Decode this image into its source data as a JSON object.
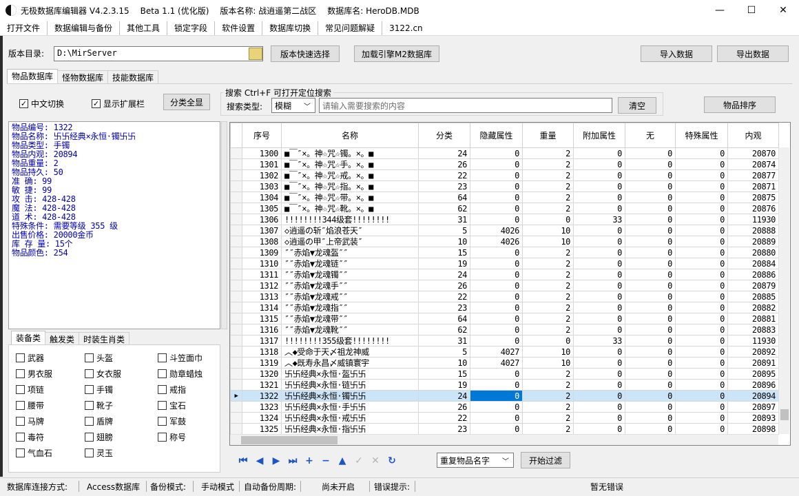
{
  "window": {
    "title_segments": [
      "无极数据库编辑器 V4.2.3.15",
      "Beta 1.1 (优化版)",
      "版本名称: 战逍遥第二战区",
      "数据库名: HeroDB.MDB"
    ],
    "minimize": "—",
    "maximize": "☐",
    "close": "✕"
  },
  "menu": [
    "打开文件",
    "数据编辑与备份",
    "其他工具",
    "锁定字段",
    "软件设置",
    "数据库切换",
    "常见问题解疑",
    "3122.cn"
  ],
  "path": {
    "label": "版本目录:",
    "value": "D:\\MirServer",
    "quick_select": "版本快速选择",
    "load_m2": "加载引擎M2数据库",
    "import": "导入数据",
    "export": "导出数据"
  },
  "top_tabs": [
    "物品数据库",
    "怪物数据库",
    "技能数据库"
  ],
  "options": {
    "cn_switch": "中文切换",
    "show_ext": "显示扩展栏",
    "show_all": "分类全显",
    "search_legend": "搜索  Ctrl+F 可打开定位搜索",
    "search_type_label": "搜索类型:",
    "search_type_value": "模糊",
    "search_placeholder": "请输入需要搜索的内容",
    "clear": "清空",
    "sort": "物品排序"
  },
  "info": [
    "物品编号: 1322",
    "物品名称: 卐卐经典×永恒·镯卐卐",
    "物品类型: 手镯",
    "物品内观: 20894",
    "物品重量: 2",
    "物品持久: 50",
    "准    确: 99",
    "敏    捷: 99",
    "攻    击: 428-428",
    "魔    法: 428-428",
    "道    术: 428-428",
    "特殊条件: 需要等级 355 级",
    "出售价格: 20000金币",
    "库 存 量: 15个",
    "物品颜色: 254"
  ],
  "cat_tabs": [
    "装备类",
    "触发类",
    "时装生肖类"
  ],
  "categories": [
    "武器",
    "头盔",
    "斗笠面巾",
    "男衣服",
    "女衣服",
    "勋章蜡烛",
    "项链",
    "手镯",
    "戒指",
    "腰带",
    "靴子",
    "宝石",
    "马牌",
    "盾牌",
    "军鼓",
    "毒符",
    "翅膀",
    "称号",
    "气血石",
    "灵玉"
  ],
  "table": {
    "columns": [
      "序号",
      "名称",
      "分类",
      "隐藏属性",
      "重量",
      "附加属性",
      "无",
      "特殊属性",
      "内观"
    ],
    "rows": [
      [
        "1300",
        "■￣″×。神☆咒☆镯。×。■",
        "24",
        "0",
        "2",
        "0",
        "0",
        "0",
        "20870"
      ],
      [
        "1301",
        "■￣″×。神☆咒☆手。×。■",
        "26",
        "0",
        "2",
        "0",
        "0",
        "0",
        "20874"
      ],
      [
        "1302",
        "■￣″×。神☆咒☆戒。×。■",
        "22",
        "0",
        "2",
        "0",
        "0",
        "0",
        "20877"
      ],
      [
        "1303",
        "■￣″×。神☆咒☆指。×。■",
        "23",
        "0",
        "2",
        "0",
        "0",
        "0",
        "20871"
      ],
      [
        "1304",
        "■￣″×。神☆咒☆带。×。■",
        "64",
        "0",
        "2",
        "0",
        "0",
        "0",
        "20875"
      ],
      [
        "1305",
        "■￣″×。神☆咒☆靴。×。■",
        "62",
        "0",
        "2",
        "0",
        "0",
        "0",
        "20876"
      ],
      [
        "1306",
        "!!!!!!!!344级套!!!!!!!!",
        "31",
        "0",
        "0",
        "33",
        "0",
        "0",
        "11930"
      ],
      [
        "1307",
        "◇逍遥の斩″焰浪苍天″",
        "5",
        "4026",
        "10",
        "0",
        "0",
        "0",
        "20888"
      ],
      [
        "1308",
        "◇逍遥の甲″上帝武装″",
        "10",
        "4026",
        "10",
        "0",
        "0",
        "0",
        "20889"
      ],
      [
        "1309",
        "″″赤焰▼龙魂盔″″",
        "15",
        "0",
        "2",
        "0",
        "0",
        "0",
        "20880"
      ],
      [
        "1310",
        "″″赤焰▼龙魂链″″",
        "19",
        "0",
        "2",
        "0",
        "0",
        "0",
        "20884"
      ],
      [
        "1311",
        "″″赤焰▼龙魂镯″″",
        "24",
        "0",
        "2",
        "0",
        "0",
        "0",
        "20886"
      ],
      [
        "1312",
        "″″赤焰▼龙魂手″″",
        "26",
        "0",
        "2",
        "0",
        "0",
        "0",
        "20879"
      ],
      [
        "1313",
        "″″赤焰▼龙魂戒″″",
        "22",
        "0",
        "2",
        "0",
        "0",
        "0",
        "20885"
      ],
      [
        "1314",
        "″″赤焰▼龙魂指″″",
        "23",
        "0",
        "2",
        "0",
        "0",
        "0",
        "20882"
      ],
      [
        "1315",
        "″″赤焰▼龙魂带″″",
        "64",
        "0",
        "2",
        "0",
        "0",
        "0",
        "20881"
      ],
      [
        "1316",
        "″″赤焰▼龙魂靴″″",
        "62",
        "0",
        "2",
        "0",
        "0",
        "0",
        "20883"
      ],
      [
        "1317",
        "!!!!!!!!355级套!!!!!!!!",
        "31",
        "0",
        "0",
        "33",
        "0",
        "0",
        "11930"
      ],
      [
        "1318",
        "︿◆受命于天〆祖龙神威",
        "5",
        "4027",
        "10",
        "0",
        "0",
        "0",
        "20892"
      ],
      [
        "1319",
        "︿◆既寿永昌〆威镇寰宇",
        "10",
        "4027",
        "10",
        "0",
        "0",
        "0",
        "20891"
      ],
      [
        "1320",
        "卐卐经典×永恒·盔卐卐",
        "15",
        "0",
        "2",
        "0",
        "0",
        "0",
        "20895"
      ],
      [
        "1321",
        "卐卐经典×永恒·链卐卐",
        "19",
        "0",
        "2",
        "0",
        "0",
        "0",
        "20896"
      ],
      [
        "1322",
        "卐卐经典×永恒·镯卐卐",
        "24",
        "0",
        "2",
        "0",
        "0",
        "0",
        "20894"
      ],
      [
        "1323",
        "卐卐经典×永恒·手卐卐",
        "26",
        "0",
        "2",
        "0",
        "0",
        "0",
        "20897"
      ],
      [
        "1324",
        "卐卐经典×永恒·戒卐卐",
        "22",
        "0",
        "2",
        "0",
        "0",
        "0",
        "20893"
      ],
      [
        "1325",
        "卐卐经典×永恒·指卐卐",
        "23",
        "0",
        "2",
        "0",
        "0",
        "0",
        "20898"
      ]
    ],
    "selected_row": "1322"
  },
  "nav": {
    "icons": [
      "first-icon",
      "prev-icon",
      "next-icon",
      "last-icon",
      "add-icon",
      "delete-icon",
      "up-icon",
      "post-icon",
      "cancel-icon",
      "refresh-icon"
    ],
    "filter_select": "重复物品名字",
    "start_filter": "开始过滤"
  },
  "status": {
    "conn_label": "数据库连接方式:",
    "conn_value": "Access数据库",
    "backup_label": "备份模式:",
    "backup_value": "手动模式",
    "auto_label": "自动备份周期:",
    "auto_value": "尚未开启",
    "error_label": "错误提示:",
    "error_value": "暂无错误"
  }
}
